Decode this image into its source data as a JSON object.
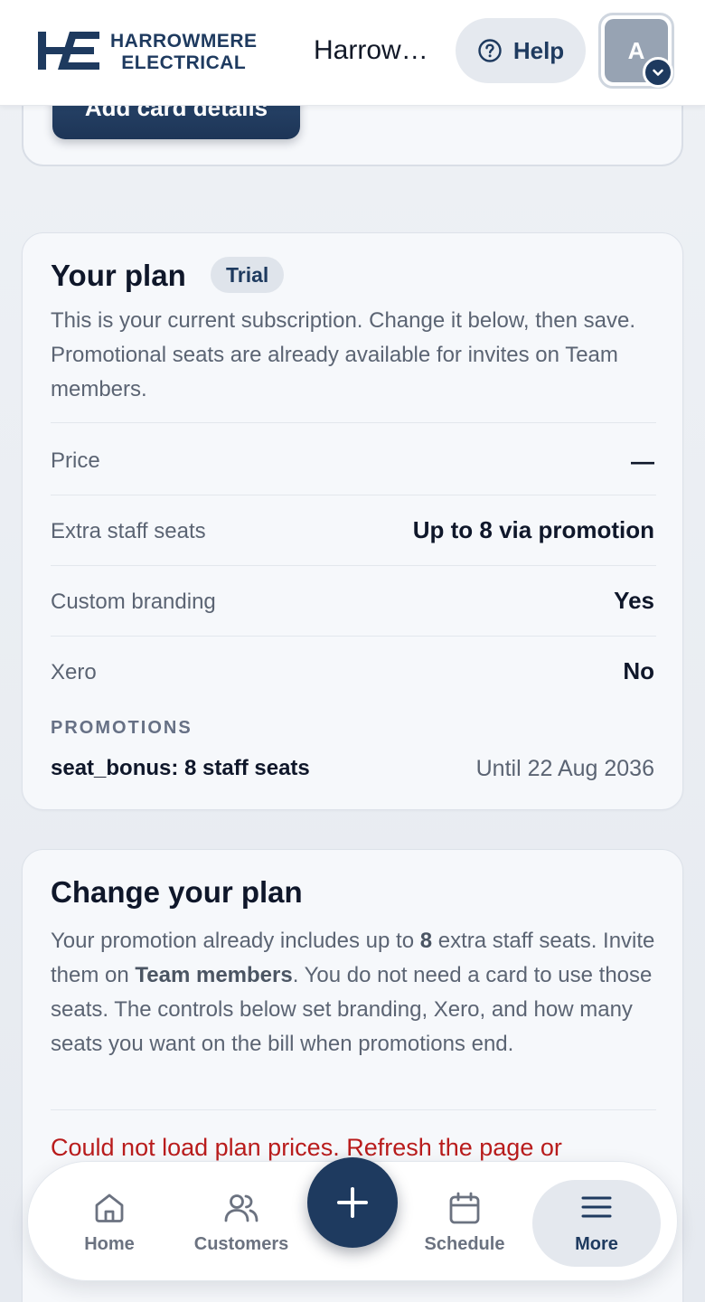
{
  "header": {
    "brand_line1": "HARROWMERE",
    "brand_line2": "ELECTRICAL",
    "org_name": "Harrowmere Electrical",
    "help_label": "Help",
    "avatar_initial": "A"
  },
  "top_card": {
    "add_card_label": "Add card details"
  },
  "plan": {
    "title": "Your plan",
    "badge": "Trial",
    "description": "This is your current subscription. Change it below, then save. Promotional seats are already available for invites on Team members.",
    "rows": [
      {
        "label": "Price",
        "value": "—"
      },
      {
        "label": "Extra staff seats",
        "value": "Up to 8 via promotion"
      },
      {
        "label": "Custom branding",
        "value": "Yes"
      },
      {
        "label": "Xero",
        "value": "No"
      }
    ],
    "promotions_heading": "PROMOTIONS",
    "promotion": {
      "name": "seat_bonus: 8 staff seats",
      "until": "Until 22 Aug 2036"
    }
  },
  "change_plan": {
    "title": "Change your plan",
    "desc_part1": "Your promotion already includes up to ",
    "desc_seats": "8",
    "desc_part2": " extra staff seats. Invite them on ",
    "desc_link": "Team members",
    "desc_part3": ". You do not need a card to use those seats. The controls below set branding, Xero, and how many seats you want on the bill when promotions end.",
    "error": "Could not load plan prices. Refresh the page or"
  },
  "nav": {
    "home": "Home",
    "customers": "Customers",
    "schedule": "Schedule",
    "more": "More"
  },
  "colors": {
    "brand": "#1e3a5f",
    "error": "#b91c1c",
    "muted_text": "#5b6473"
  }
}
